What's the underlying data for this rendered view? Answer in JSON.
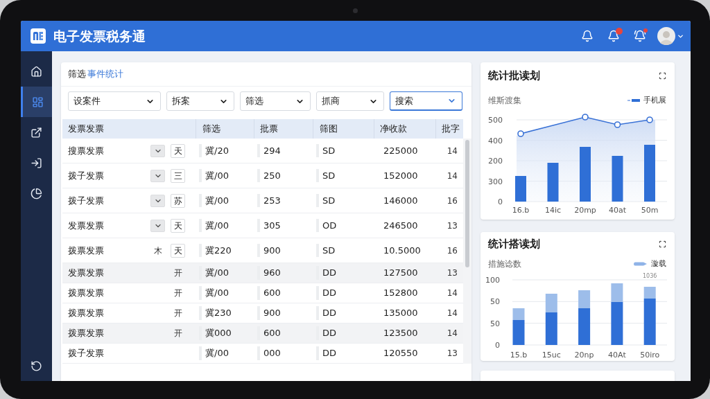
{
  "header": {
    "title": "电子发票税务通",
    "icons": [
      {
        "alert": false
      },
      {
        "alert": true
      },
      {
        "alert": true
      }
    ]
  },
  "sidebar": {
    "items": [
      {
        "selected": false
      },
      {
        "selected": true
      },
      {
        "selected": false
      },
      {
        "selected": false
      },
      {
        "selected": false
      },
      {
        "selected": false
      }
    ]
  },
  "filter_panel": {
    "title": "筛选",
    "title_link": "事件统计",
    "filters": [
      {
        "label": "设案件",
        "focused": false
      },
      {
        "label": "拆案",
        "focused": false
      },
      {
        "label": "筛选",
        "focused": false
      },
      {
        "label": "抓商",
        "focused": false
      },
      {
        "label": "搜索",
        "focused": true
      }
    ]
  },
  "table": {
    "columns": [
      "发票发票",
      "筛选",
      "批票",
      "筛图",
      "净收款",
      "批字"
    ],
    "rows": [
      {
        "cells": [
          {
            "text": "搜票发票",
            "tags": [
              {
                "kind": "chevron"
              },
              {
                "kind": "boxed",
                "label": "天"
              }
            ]
          },
          "冀/20",
          "294",
          "SD",
          "225000",
          "14"
        ],
        "shaded": false
      },
      {
        "cells": [
          {
            "text": "拨子发票",
            "tags": [
              {
                "kind": "chevron"
              },
              {
                "kind": "boxed",
                "label": "三"
              }
            ]
          },
          "冀/00",
          "250",
          "SD",
          "152000",
          "14"
        ],
        "shaded": false
      },
      {
        "cells": [
          {
            "text": "拨子发票",
            "tags": [
              {
                "kind": "chevron"
              },
              {
                "kind": "boxed",
                "label": "苏"
              }
            ]
          },
          "冀/00",
          "253",
          "SD",
          "146000",
          "16"
        ],
        "shaded": false
      },
      {
        "cells": [
          {
            "text": "发票发票",
            "tags": [
              {
                "kind": "chevron"
              },
              {
                "kind": "boxed",
                "label": "天"
              }
            ]
          },
          "冀/00",
          "305",
          "OD",
          "246500",
          "13"
        ],
        "shaded": false
      },
      {
        "cells": [
          {
            "text": "拨票发票",
            "tags": [
              {
                "kind": "plain",
                "label": "木"
              },
              {
                "kind": "boxed",
                "label": "天"
              }
            ]
          },
          "冀220",
          "900",
          "SD",
          "10.5000",
          "16"
        ],
        "shaded": false
      },
      {
        "cells": [
          {
            "text": "发票发票",
            "tags": [
              {
                "kind": "plain",
                "label": "开"
              }
            ]
          },
          "冀/00",
          "960",
          "DD",
          "127500",
          "13"
        ],
        "shaded": true
      },
      {
        "cells": [
          {
            "text": "拨票发票",
            "tags": [
              {
                "kind": "plain",
                "label": "开"
              }
            ]
          },
          "冀/00",
          "600",
          "DD",
          "152800",
          "14"
        ],
        "shaded": false
      },
      {
        "cells": [
          {
            "text": "拨票发票",
            "tags": [
              {
                "kind": "plain",
                "label": "开"
              }
            ]
          },
          "冀230",
          "900",
          "DD",
          "135000",
          "14"
        ],
        "shaded": false
      },
      {
        "cells": [
          {
            "text": "拨票发票",
            "tags": [
              {
                "kind": "plain",
                "label": "开"
              }
            ]
          },
          "冀000",
          "600",
          "DD",
          "123500",
          "14"
        ],
        "shaded": true
      },
      {
        "cells": [
          {
            "text": "拨子发票"
          },
          "冀/00",
          "000",
          "DD",
          "120550",
          "13"
        ],
        "shaded": false
      }
    ]
  },
  "charts": [
    {
      "kind": "bar-line",
      "title": "统计批读划",
      "subtitle": "维斯渡集",
      "legend": "手机展",
      "y_labels": [
        "500",
        "400",
        "200",
        "300",
        "0"
      ],
      "x_labels": [
        "16.b",
        "14ic",
        "20mp",
        "40at",
        "50m"
      ]
    },
    {
      "kind": "stacked-bar",
      "title": "统计搭读划",
      "subtitle": "措施谂数",
      "legend": "漩载",
      "note": "1036",
      "y_labels": [
        "100",
        "50",
        "50",
        "0"
      ],
      "x_labels": [
        "15.b",
        "15uc",
        "20np",
        "40At",
        "50iro"
      ]
    }
  ]
}
